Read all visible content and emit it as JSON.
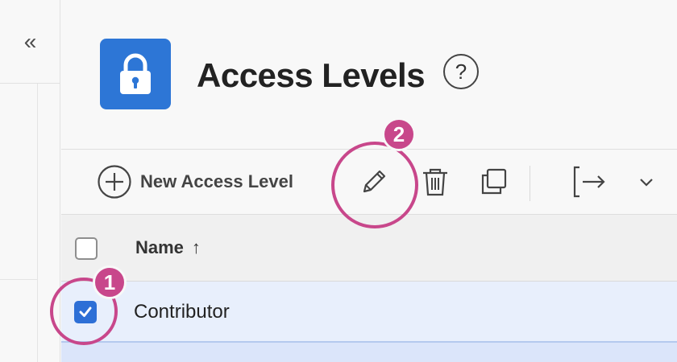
{
  "rail": {
    "collapse_glyph": "«"
  },
  "header": {
    "title": "Access Levels",
    "help_glyph": "?",
    "tile_color": "#2d76d6",
    "tile_icon": "lock-icon"
  },
  "toolbar": {
    "new_label": "New Access Level",
    "icons": [
      "plus-circle-icon",
      "pencil-icon",
      "trash-icon",
      "duplicate-icon",
      "export-icon",
      "chevron-down-icon"
    ]
  },
  "table": {
    "columns": [
      {
        "label": "Name",
        "sort": "ascending",
        "sort_glyph": "↑"
      }
    ],
    "rows": [
      {
        "name": "Contributor",
        "selected": true
      }
    ]
  },
  "callouts": [
    {
      "number": "1",
      "target": "row-checkbox"
    },
    {
      "number": "2",
      "target": "edit-button"
    }
  ],
  "colors": {
    "accent": "#2d6fd6",
    "callout": "#c8478b",
    "selected_row": "#e8effc"
  }
}
